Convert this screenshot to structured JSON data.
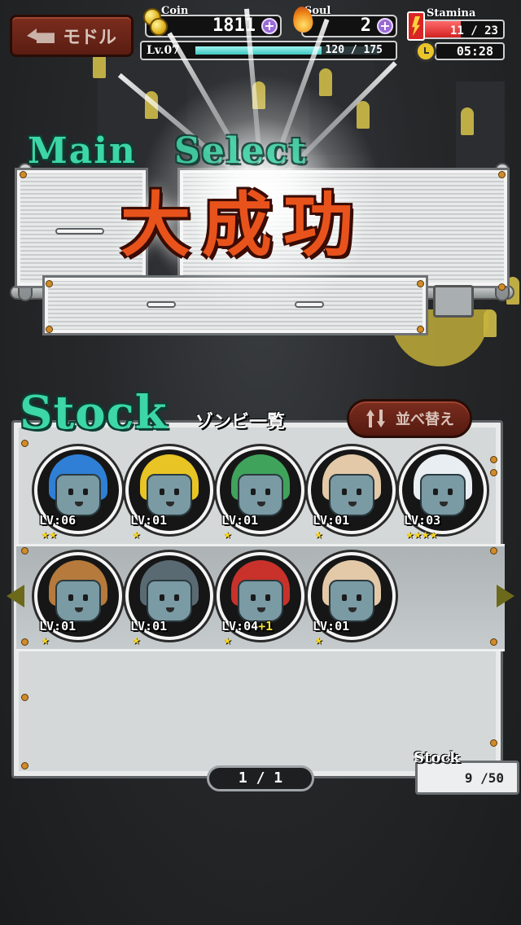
{
  "hud": {
    "back_label": "モドル",
    "coin_title": "Coin",
    "coin_value": "1811",
    "soul_title": "Soul",
    "soul_value": "2",
    "plus_symbol": "+",
    "level_label": "Lv.07",
    "exp_text": "120 / 175",
    "exp_fraction": 0.686,
    "stamina_title": "Stamina",
    "stamina_text": "11 / 23",
    "stamina_fraction": 0.478,
    "timer": "05:28"
  },
  "banner": {
    "main": "Main",
    "select": "Select",
    "result": "大成功"
  },
  "stock": {
    "title": "Stock",
    "subtitle": "ゾンビ一覧",
    "sort_label": "並べ替え",
    "page": "1 / 1",
    "count_title": "Stock",
    "count": "9 /50",
    "zombies": [
      {
        "level": "LV:06",
        "plus": "",
        "stars": "★★",
        "hair": "#2f7fd6",
        "icon": "blue-spiky-zombie-icon"
      },
      {
        "level": "LV:01",
        "plus": "",
        "stars": "★",
        "hair": "#e8c524",
        "icon": "yellow-hood-zombie-icon"
      },
      {
        "level": "LV:01",
        "plus": "",
        "stars": "★",
        "hair": "#3fa35c",
        "icon": "green-hair-zombie-icon"
      },
      {
        "level": "LV:01",
        "plus": "",
        "stars": "★",
        "hair": "#e3c9a8",
        "icon": "beanie-zombie-icon"
      },
      {
        "level": "LV:03",
        "plus": "",
        "stars": "★★★★",
        "hair": "#e9eef2",
        "icon": "luchador-mask-zombie-icon"
      },
      {
        "level": "LV:01",
        "plus": "",
        "stars": "★",
        "hair": "#b57a3c",
        "icon": "brown-hair-zombie-icon"
      },
      {
        "level": "LV:01",
        "plus": "",
        "stars": "★",
        "hair": "#5a6a72",
        "icon": "gray-hair-zombie-icon"
      },
      {
        "level": "LV:04",
        "plus": "+1",
        "stars": "★",
        "hair": "#c8322a",
        "icon": "headband-zombie-icon"
      },
      {
        "level": "LV:01",
        "plus": "",
        "stars": "★",
        "hair": "#e3c9a8",
        "icon": "beanie-zombie-icon"
      }
    ]
  }
}
